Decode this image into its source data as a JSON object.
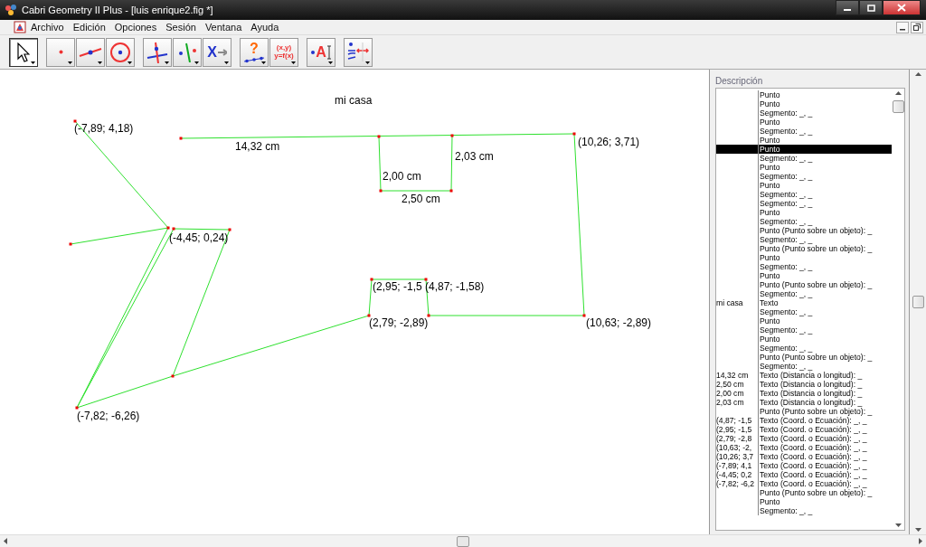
{
  "window": {
    "title": "Cabri Geometry II Plus - [luis enrique2.fig *]"
  },
  "menu": [
    "Archivo",
    "Edición",
    "Opciones",
    "Sesión",
    "Ventana",
    "Ayuda"
  ],
  "toolbar": [
    {
      "kind": "pointer",
      "selected": true
    },
    {
      "kind": "point",
      "selected": false
    },
    {
      "kind": "line",
      "selected": false
    },
    {
      "kind": "circle",
      "selected": false
    },
    {
      "kind": "perpendicular",
      "selected": false
    },
    {
      "kind": "symmetry",
      "selected": false
    },
    {
      "kind": "transform",
      "glyph": "X",
      "selected": false
    },
    {
      "kind": "check",
      "glyph": "?",
      "selected": false
    },
    {
      "kind": "measure",
      "glyph": "(x,y)",
      "glyph2": "y=f(x)",
      "selected": false
    },
    {
      "kind": "text",
      "glyph": "A",
      "selected": false
    },
    {
      "kind": "attributes",
      "selected": false
    }
  ],
  "canvas": {
    "labels": [
      {
        "text": "mi casa"
      },
      {
        "text": "(-7,89; 4,18)"
      },
      {
        "text": "14,32 cm"
      },
      {
        "text": "(10,26; 3,71)"
      },
      {
        "text": "2,03 cm"
      },
      {
        "text": "2,00 cm"
      },
      {
        "text": "2,50 cm"
      },
      {
        "text": "(-4,45; 0,24)"
      },
      {
        "text": "(2,95; -1,5"
      },
      {
        "text": "(4,87; -1,58)"
      },
      {
        "text": "(2,79; -2,89)"
      },
      {
        "text": "(10,63; -2,89)"
      },
      {
        "text": "(-7,82; -6,26)"
      }
    ]
  },
  "description": {
    "title": "Descripción",
    "rows": [
      {
        "type": "Punto",
        "selected": false
      },
      {
        "type": "Punto",
        "selected": false
      },
      {
        "type": "Segmento: _, _",
        "selected": false
      },
      {
        "type": "Punto",
        "selected": false
      },
      {
        "type": "Segmento: _, _",
        "selected": false
      },
      {
        "type": "Punto",
        "selected": false
      },
      {
        "type": "Punto",
        "selected": true
      },
      {
        "type": "Segmento: _, _",
        "selected": false
      },
      {
        "type": "Punto",
        "selected": false
      },
      {
        "type": "Segmento: _, _",
        "selected": false
      },
      {
        "type": "Punto",
        "selected": false
      },
      {
        "type": "Segmento: _, _",
        "selected": false
      },
      {
        "type": "Segmento: _, _",
        "selected": false
      },
      {
        "type": "Punto",
        "selected": false
      },
      {
        "type": "Segmento: _, _",
        "selected": false
      },
      {
        "type": "Punto (Punto sobre un objeto): _",
        "selected": false
      },
      {
        "type": "Segmento: _, _",
        "selected": false
      },
      {
        "type": "Punto (Punto sobre un objeto): _",
        "selected": false
      },
      {
        "type": "Punto",
        "selected": false
      },
      {
        "type": "Segmento: _, _",
        "selected": false
      },
      {
        "type": "Punto",
        "selected": false
      },
      {
        "type": "Punto (Punto sobre un objeto): _",
        "selected": false
      },
      {
        "type": "Segmento: _, _",
        "selected": false
      },
      {
        "name": "mi casa",
        "type": "Texto",
        "selected": false
      },
      {
        "type": "Segmento: _, _",
        "selected": false
      },
      {
        "type": "Punto",
        "selected": false
      },
      {
        "type": "Segmento: _, _",
        "selected": false
      },
      {
        "type": "Punto",
        "selected": false
      },
      {
        "type": "Segmento: _, _",
        "selected": false
      },
      {
        "type": "Punto (Punto sobre un objeto): _",
        "selected": false
      },
      {
        "type": "Segmento: _, _",
        "selected": false
      },
      {
        "name": "14,32 cm",
        "type": "Texto (Distancia o longitud): _",
        "selected": false
      },
      {
        "name": "2,50 cm",
        "type": "Texto (Distancia o longitud): _",
        "selected": false
      },
      {
        "name": "2,00 cm",
        "type": "Texto (Distancia o longitud): _",
        "selected": false
      },
      {
        "name": "2,03 cm",
        "type": "Texto (Distancia o longitud): _",
        "selected": false
      },
      {
        "type": "Punto (Punto sobre un objeto): _",
        "selected": false
      },
      {
        "name": "(4,87; -1,5",
        "type": "Texto (Coord. o Ecuación): _, _",
        "selected": false
      },
      {
        "name": "(2,95; -1,5",
        "type": "Texto (Coord. o Ecuación): _, _",
        "selected": false
      },
      {
        "name": "(2,79; -2,8",
        "type": "Texto (Coord. o Ecuación): _, _",
        "selected": false
      },
      {
        "name": "(10,63; -2,",
        "type": "Texto (Coord. o Ecuación): _, _",
        "selected": false
      },
      {
        "name": "(10,26; 3,7",
        "type": "Texto (Coord. o Ecuación): _, _",
        "selected": false
      },
      {
        "name": "(-7,89; 4,1",
        "type": "Texto (Coord. o Ecuación): _, _",
        "selected": false
      },
      {
        "name": "(-4,45; 0,2",
        "type": "Texto (Coord. o Ecuación): _, _",
        "selected": false
      },
      {
        "name": "(-7,82; -6,2",
        "type": "Texto (Coord. o Ecuación): _, _",
        "selected": false
      },
      {
        "type": "Punto (Punto sobre un objeto): _",
        "selected": false
      },
      {
        "type": "Punto",
        "selected": false
      },
      {
        "type": "Segmento: _, _",
        "selected": false
      }
    ]
  }
}
